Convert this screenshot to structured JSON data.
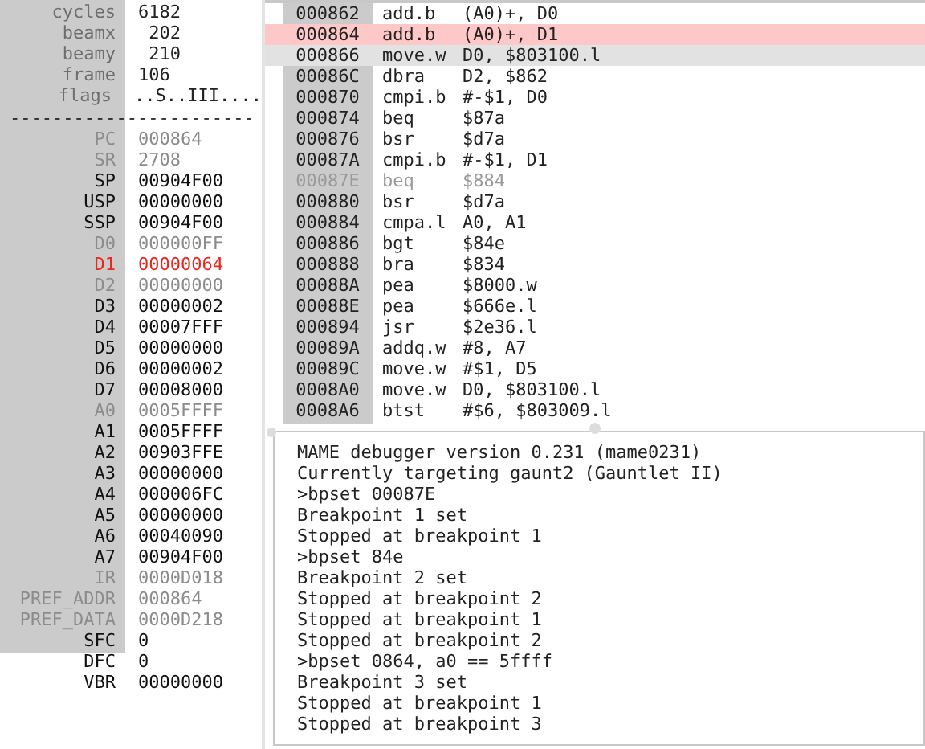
{
  "info": [
    {
      "label": "cycles",
      "value": "6182"
    },
    {
      "label": "beamx",
      "value": " 202"
    },
    {
      "label": "beamy",
      "value": " 210"
    },
    {
      "label": "frame",
      "value": "106"
    },
    {
      "label": "flags",
      "value": "..S..III...."
    }
  ],
  "separator": "-----------------------",
  "registers": [
    {
      "name": "PC",
      "value": "000864",
      "kind": "dim"
    },
    {
      "name": "SR",
      "value": "2708",
      "kind": "dim"
    },
    {
      "name": "SP",
      "value": "00904F00",
      "kind": "normal"
    },
    {
      "name": "USP",
      "value": "00000000",
      "kind": "normal"
    },
    {
      "name": "SSP",
      "value": "00904F00",
      "kind": "normal"
    },
    {
      "name": "D0",
      "value": "000000FF",
      "kind": "dim"
    },
    {
      "name": "D1",
      "value": "00000064",
      "kind": "changed"
    },
    {
      "name": "D2",
      "value": "00000000",
      "kind": "dim"
    },
    {
      "name": "D3",
      "value": "00000002",
      "kind": "normal"
    },
    {
      "name": "D4",
      "value": "00007FFF",
      "kind": "normal"
    },
    {
      "name": "D5",
      "value": "00000000",
      "kind": "normal"
    },
    {
      "name": "D6",
      "value": "00000002",
      "kind": "normal"
    },
    {
      "name": "D7",
      "value": "00008000",
      "kind": "normal"
    },
    {
      "name": "A0",
      "value": "0005FFFF",
      "kind": "dim"
    },
    {
      "name": "A1",
      "value": "0005FFFF",
      "kind": "normal"
    },
    {
      "name": "A2",
      "value": "00903FFE",
      "kind": "normal"
    },
    {
      "name": "A3",
      "value": "00000000",
      "kind": "normal"
    },
    {
      "name": "A4",
      "value": "000006FC",
      "kind": "normal"
    },
    {
      "name": "A5",
      "value": "00000000",
      "kind": "normal"
    },
    {
      "name": "A6",
      "value": "00040090",
      "kind": "normal"
    },
    {
      "name": "A7",
      "value": "00904F00",
      "kind": "normal"
    },
    {
      "name": "IR",
      "value": "0000D018",
      "kind": "dim"
    },
    {
      "name": "PREF_ADDR",
      "value": "000864",
      "kind": "dim"
    },
    {
      "name": "PREF_DATA",
      "value": "0000D218",
      "kind": "dim"
    },
    {
      "name": "SFC",
      "value": "0",
      "kind": "normal"
    },
    {
      "name": "DFC",
      "value": "0",
      "kind": "normal"
    },
    {
      "name": "VBR",
      "value": "00000000",
      "kind": "normal"
    }
  ],
  "disassembly": [
    {
      "address": "000862",
      "mnemonic": "add.b",
      "operands": "(A0)+, D0",
      "kind": "normal",
      "disabled": false
    },
    {
      "address": "000864",
      "mnemonic": "add.b",
      "operands": "(A0)+, D1",
      "kind": "current",
      "disabled": false
    },
    {
      "address": "000866",
      "mnemonic": "move.w",
      "operands": "D0, $803100.l",
      "kind": "cursor",
      "disabled": false
    },
    {
      "address": "00086C",
      "mnemonic": "dbra",
      "operands": "D2, $862",
      "kind": "normal",
      "disabled": false
    },
    {
      "address": "000870",
      "mnemonic": "cmpi.b",
      "operands": "#-$1, D0",
      "kind": "normal",
      "disabled": false
    },
    {
      "address": "000874",
      "mnemonic": "beq",
      "operands": "$87a",
      "kind": "normal",
      "disabled": false
    },
    {
      "address": "000876",
      "mnemonic": "bsr",
      "operands": "$d7a",
      "kind": "normal",
      "disabled": false
    },
    {
      "address": "00087A",
      "mnemonic": "cmpi.b",
      "operands": "#-$1, D1",
      "kind": "normal",
      "disabled": false
    },
    {
      "address": "00087E",
      "mnemonic": "beq",
      "operands": "$884",
      "kind": "normal",
      "disabled": true
    },
    {
      "address": "000880",
      "mnemonic": "bsr",
      "operands": "$d7a",
      "kind": "normal",
      "disabled": false
    },
    {
      "address": "000884",
      "mnemonic": "cmpa.l",
      "operands": "A0, A1",
      "kind": "normal",
      "disabled": false
    },
    {
      "address": "000886",
      "mnemonic": "bgt",
      "operands": "$84e",
      "kind": "normal",
      "disabled": false
    },
    {
      "address": "000888",
      "mnemonic": "bra",
      "operands": "$834",
      "kind": "normal",
      "disabled": false
    },
    {
      "address": "00088A",
      "mnemonic": "pea",
      "operands": "$8000.w",
      "kind": "normal",
      "disabled": false
    },
    {
      "address": "00088E",
      "mnemonic": "pea",
      "operands": "$666e.l",
      "kind": "normal",
      "disabled": false
    },
    {
      "address": "000894",
      "mnemonic": "jsr",
      "operands": "$2e36.l",
      "kind": "normal",
      "disabled": false
    },
    {
      "address": "00089A",
      "mnemonic": "addq.w",
      "operands": "#8, A7",
      "kind": "normal",
      "disabled": false
    },
    {
      "address": "00089C",
      "mnemonic": "move.w",
      "operands": "#$1, D5",
      "kind": "normal",
      "disabled": false
    },
    {
      "address": "0008A0",
      "mnemonic": "move.w",
      "operands": "D0, $803100.l",
      "kind": "normal",
      "disabled": false
    },
    {
      "address": "0008A6",
      "mnemonic": "btst",
      "operands": "#$6, $803009.l",
      "kind": "normal",
      "disabled": false
    }
  ],
  "console": [
    "MAME debugger version 0.231 (mame0231)",
    "Currently targeting gaunt2 (Gauntlet II)",
    ">bpset 00087E",
    "Breakpoint 1 set",
    "Stopped at breakpoint 1",
    ">bpset 84e",
    "Breakpoint 2 set",
    "Stopped at breakpoint 2",
    "Stopped at breakpoint 1",
    "Stopped at breakpoint 2",
    ">bpset 0864, a0 == 5ffff",
    "Breakpoint 3 set",
    "Stopped at breakpoint 1",
    "Stopped at breakpoint 3"
  ]
}
